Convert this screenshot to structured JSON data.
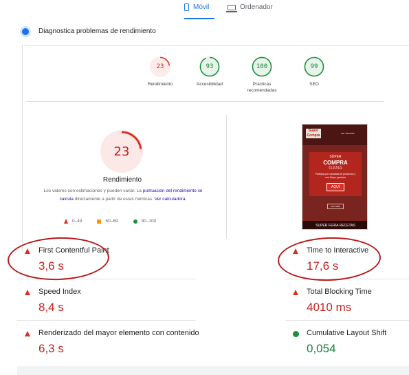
{
  "tabs": {
    "mobile": {
      "label": "Móvil",
      "icon": "phone-icon"
    },
    "desktop": {
      "label": "Ordenador",
      "icon": "laptop-icon"
    }
  },
  "diagnostics": {
    "title": "Diagnostica problemas de rendimiento"
  },
  "categories": [
    {
      "score": "23",
      "label": "Rendimiento",
      "status": "poor"
    },
    {
      "score": "93",
      "label": "Accesibilidad",
      "status": "good"
    },
    {
      "score": "100",
      "label_line1": "Prácticas",
      "label_line2": "recomendadas",
      "status": "good"
    },
    {
      "score": "99",
      "label": "SEO",
      "status": "good"
    }
  ],
  "performance": {
    "score": "23",
    "score_fraction": 0.23,
    "title": "Rendimiento",
    "desc_part1": "Los valores son estimaciones y pueden variar. La ",
    "desc_link1": "puntuación del rendimiento se calcula",
    "desc_part2": " directamente a partir de estas métricas. ",
    "desc_link2": "Ver calculadora."
  },
  "legend": {
    "poor": "0–49",
    "average": "50–89",
    "good": "90–100"
  },
  "preview": {
    "logo": "Super Compra",
    "top_text": "ver tiendas",
    "promo_line1": "SÚPER",
    "promo_line2": "COMPRA",
    "promo_line3": "GANA",
    "promo_small": "Participa por canastas de productos y una Súper gandola",
    "button": "AQUÍ",
    "pill": "ver más",
    "footer": "SUPER FERIA RECETAS"
  },
  "metrics": [
    {
      "name": "First Contentful Paint",
      "value": "3,6 s",
      "status": "poor"
    },
    {
      "name": "Time to Interactive",
      "value": "17,6 s",
      "status": "poor"
    },
    {
      "name": "Speed Index",
      "value": "8,4 s",
      "status": "poor"
    },
    {
      "name": "Total Blocking Time",
      "value": "4010 ms",
      "status": "poor"
    },
    {
      "name": "Renderizado del mayor elemento con contenido",
      "value": "6,3 s",
      "status": "poor"
    },
    {
      "name": "Cumulative Layout Shift",
      "value": "0,054",
      "status": "good"
    }
  ],
  "colors": {
    "poor": "#d93025",
    "average": "#f29900",
    "good": "#1e8e3e",
    "link": "#1a0dab",
    "accent": "#1a73e8",
    "annotation": "#b71c1c"
  }
}
